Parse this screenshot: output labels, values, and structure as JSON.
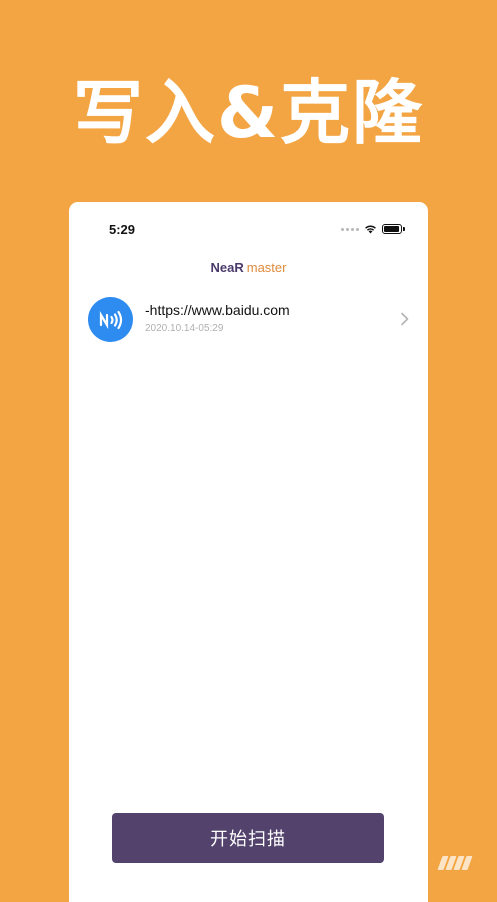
{
  "headline": "写入&克隆",
  "status_bar": {
    "time": "5:29"
  },
  "app": {
    "logo_brand": "NeaR",
    "logo_sub": "master"
  },
  "records": [
    {
      "title": "-https://www.baidu.com",
      "timestamp": "2020.10.14-05:29",
      "icon": "nfc-icon"
    }
  ],
  "actions": {
    "scan_label": "开始扫描"
  },
  "colors": {
    "background": "#F3A443",
    "phone_bg": "#ffffff",
    "nfc_blue": "#2E8CF0",
    "button_purple": "#52426C",
    "logo_purple": "#4a3a6b",
    "logo_orange": "#E08B3B"
  }
}
